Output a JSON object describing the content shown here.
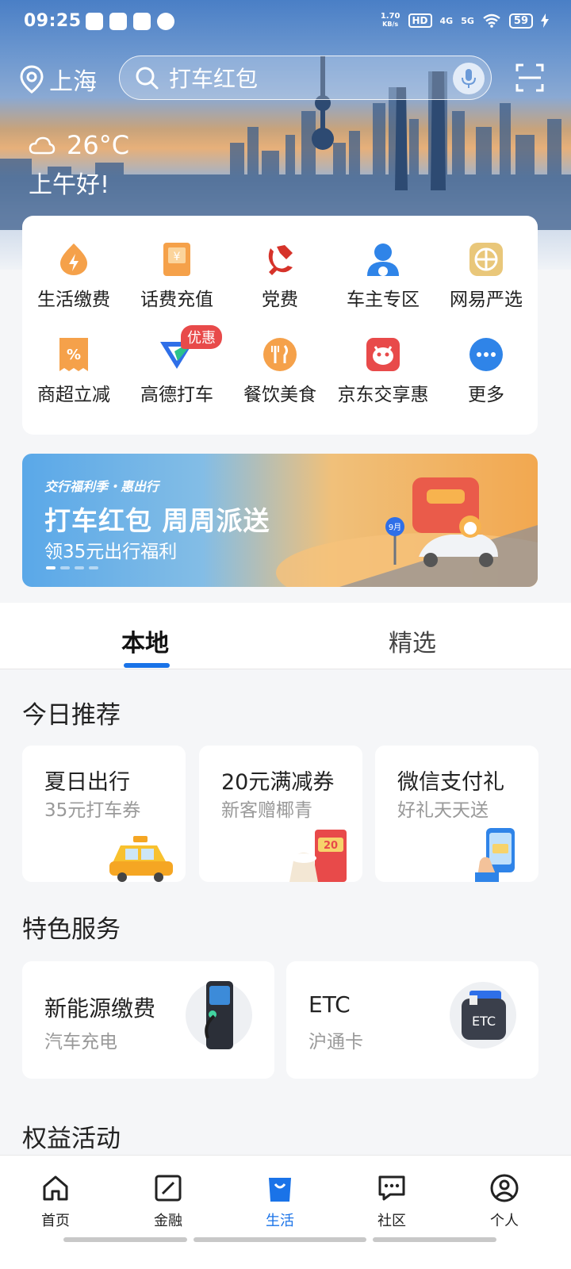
{
  "status_bar": {
    "time": "09:25",
    "net_speed": "1.70",
    "net_unit": "KB/s",
    "hd": "HD",
    "sig1": "4G",
    "sig2": "5G",
    "battery": "59"
  },
  "header": {
    "city": "上海",
    "search_placeholder": "打车红包",
    "temperature": "26°C",
    "greeting": "上午好!"
  },
  "services": [
    {
      "label": "生活缴费",
      "icon": "bolt-icon",
      "color": "#f5a14a"
    },
    {
      "label": "话费充值",
      "icon": "phone-bill-icon",
      "color": "#f5a14a"
    },
    {
      "label": "党费",
      "icon": "party-emblem-icon",
      "color": "#d6332a"
    },
    {
      "label": "车主专区",
      "icon": "car-owner-icon",
      "color": "#2f84e8"
    },
    {
      "label": "网易严选",
      "icon": "netease-icon",
      "color": "#e9c77a"
    },
    {
      "label": "商超立减",
      "icon": "discount-icon",
      "color": "#f5a14a"
    },
    {
      "label": "高德打车",
      "icon": "amap-taxi-icon",
      "color": "#2f6fe8",
      "badge": "优惠"
    },
    {
      "label": "餐饮美食",
      "icon": "dining-icon",
      "color": "#f5a14a"
    },
    {
      "label": "京东交享惠",
      "icon": "jd-icon",
      "color": "#e84a4a"
    },
    {
      "label": "更多",
      "icon": "more-icon",
      "color": "#2f84e8"
    }
  ],
  "banner": {
    "tag": "交行福利季・惠出行",
    "title": "打车红包 周周派送",
    "subtitle": "领35元出行福利",
    "sign_text": "9月"
  },
  "tabs": [
    {
      "label": "本地",
      "active": true
    },
    {
      "label": "精选",
      "active": false
    }
  ],
  "today": {
    "title": "今日推荐",
    "cards": [
      {
        "title": "夏日出行",
        "subtitle": "35元打车券"
      },
      {
        "title": "20元满减券",
        "subtitle": "新客赠椰青",
        "art_text": "20"
      },
      {
        "title": "微信支付礼",
        "subtitle": "好礼天天送"
      }
    ]
  },
  "featured": {
    "title": "特色服务",
    "cards": [
      {
        "title": "新能源缴费",
        "subtitle": "汽车充电"
      },
      {
        "title": "ETC",
        "subtitle": "沪通卡",
        "art_text": "ETC"
      }
    ]
  },
  "rights": {
    "title": "权益活动"
  },
  "bottom_nav": [
    {
      "label": "首页",
      "icon": "home-icon",
      "active": false
    },
    {
      "label": "金融",
      "icon": "finance-icon",
      "active": false
    },
    {
      "label": "生活",
      "icon": "shopping-bag-icon",
      "active": true
    },
    {
      "label": "社区",
      "icon": "chat-icon",
      "active": false
    },
    {
      "label": "个人",
      "icon": "user-icon",
      "active": false
    }
  ],
  "colors": {
    "accent": "#1a73e8",
    "badge": "#e84a4a"
  }
}
